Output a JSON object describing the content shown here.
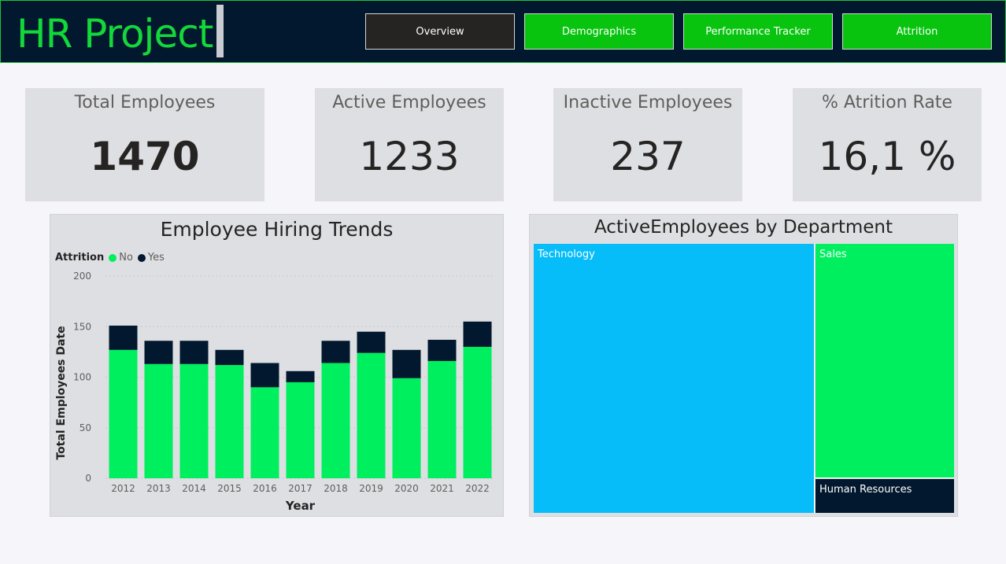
{
  "header": {
    "title": "HR Project",
    "tabs": [
      {
        "label": "Overview",
        "active": true
      },
      {
        "label": "Demographics",
        "active": false
      },
      {
        "label": "Performance Tracker",
        "active": false
      },
      {
        "label": "Attrition",
        "active": false
      }
    ]
  },
  "kpis": [
    {
      "label": "Total Employees",
      "value": "1470"
    },
    {
      "label": "Active Employees",
      "value": "1233"
    },
    {
      "label": "Inactive Employees",
      "value": "237"
    },
    {
      "label": "% Atrition Rate",
      "value": "16,1 %"
    }
  ],
  "colors": {
    "no": "#00ef5f",
    "yes": "#02182e",
    "technology": "#06bdf9",
    "sales": "#00ef5f",
    "human_resources": "#02182e"
  },
  "hiring_chart": {
    "title": "Employee Hiring Trends",
    "legend_title": "Attrition",
    "legend": [
      "No",
      "Yes"
    ]
  },
  "chart_data": [
    {
      "type": "bar",
      "stacked": true,
      "title": "Employee Hiring Trends",
      "xlabel": "Year",
      "ylabel": "Total Employees Date",
      "ylim": [
        0,
        200
      ],
      "yticks": [
        0,
        50,
        100,
        150,
        200
      ],
      "grid": true,
      "legend_title": "Attrition",
      "legend_position": "top-left",
      "categories": [
        "2012",
        "2013",
        "2014",
        "2015",
        "2016",
        "2017",
        "2018",
        "2019",
        "2020",
        "2021",
        "2022"
      ],
      "series": [
        {
          "name": "No",
          "values": [
            127,
            113,
            113,
            112,
            90,
            95,
            114,
            124,
            99,
            116,
            130
          ]
        },
        {
          "name": "Yes",
          "values": [
            24,
            23,
            23,
            15,
            24,
            11,
            22,
            21,
            28,
            21,
            25
          ]
        }
      ]
    },
    {
      "type": "treemap",
      "title": "ActiveEmployees by Department",
      "categories": [
        "Technology",
        "Sales",
        "Human Resources"
      ],
      "values": [
        828,
        354,
        51
      ]
    }
  ]
}
